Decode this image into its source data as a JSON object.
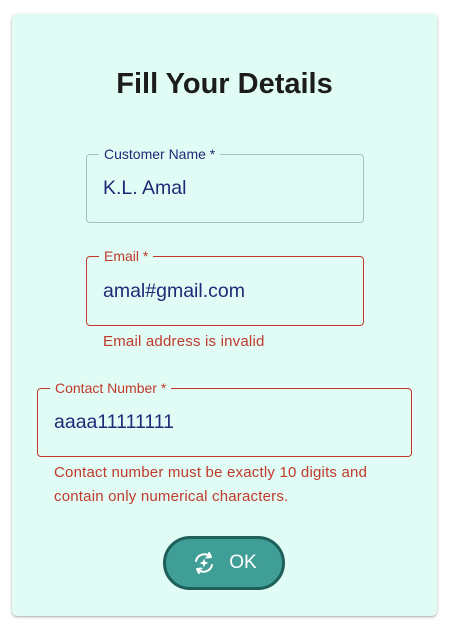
{
  "form": {
    "title": "Fill Your Details",
    "customer_name": {
      "label": "Customer Name *",
      "value": "K.L. Amal"
    },
    "email": {
      "label": "Email *",
      "value": "amal#gmail.com",
      "error": "Email address is invalid"
    },
    "contact_number": {
      "label": "Contact Number *",
      "value": "aaaa11111111",
      "error_line1": "Contact number must be exactly 10 digits and",
      "error_line2": "contain only numerical characters."
    },
    "ok_button": {
      "label": "OK",
      "icon": "autorenew-sparkle-icon"
    }
  },
  "colors": {
    "card_background": "#e0fcf4",
    "title_text": "#1c1c1c",
    "input_text": "#1e2a78",
    "error": "#c0392b",
    "button_fill": "#3f9e96",
    "button_border": "#1e5f5a"
  }
}
